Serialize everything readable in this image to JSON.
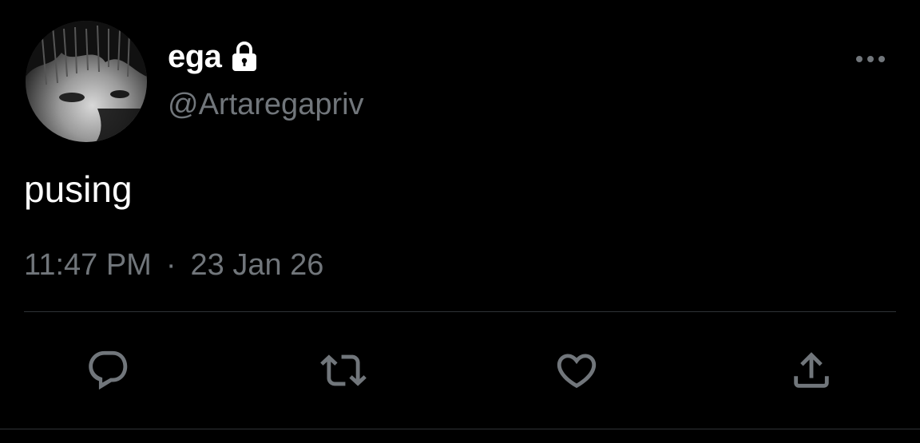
{
  "user": {
    "display_name": "ega",
    "handle": "@Artaregapriv",
    "locked_icon": "lock-icon",
    "avatar": "avatar"
  },
  "tweet": {
    "text": "pusing",
    "time": "11:47 PM",
    "separator": "·",
    "date": "23 Jan 26"
  },
  "actions": {
    "more_icon": "more-icon",
    "reply_icon": "reply-icon",
    "retweet_icon": "retweet-icon",
    "like_icon": "like-icon",
    "share_icon": "share-icon"
  },
  "colors": {
    "background": "#000000",
    "primary_text": "#ffffff",
    "secondary_text": "#71767b",
    "divider": "#2f3336"
  }
}
